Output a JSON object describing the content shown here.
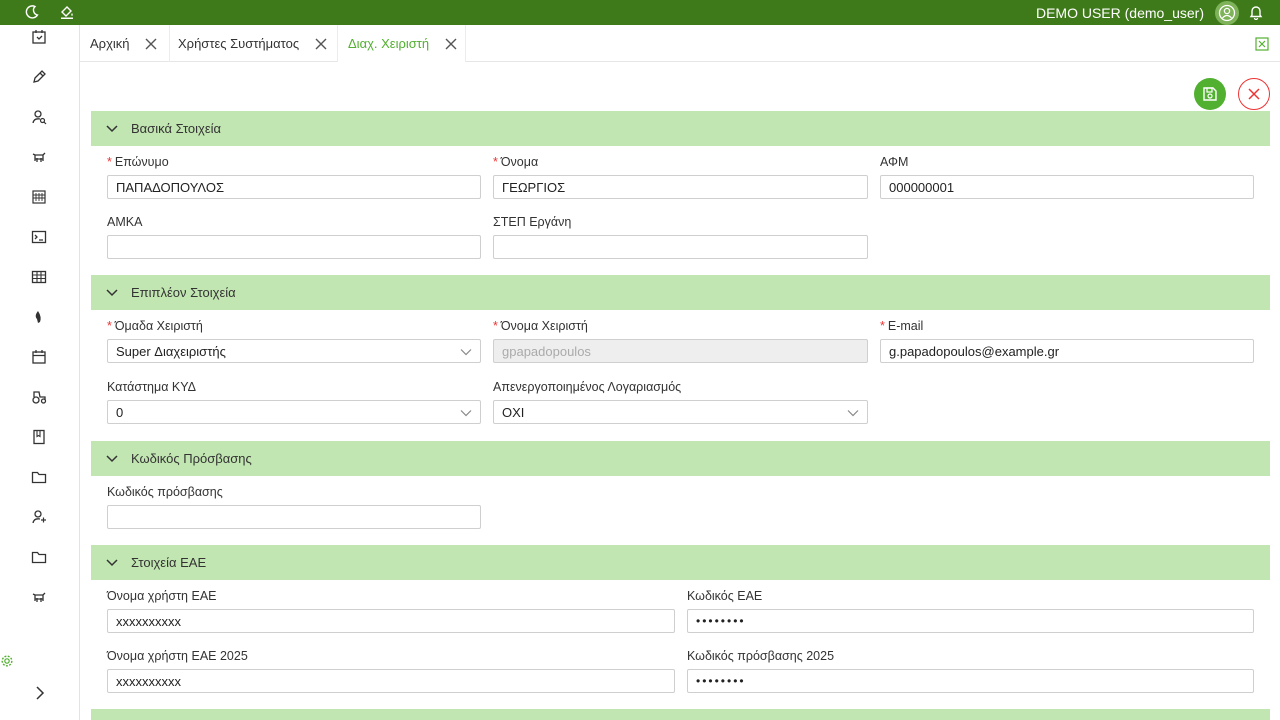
{
  "header": {
    "user_name": "DEMO USER (demo_user)"
  },
  "sidebar": {
    "items": [
      {
        "icon": "calendar-check-icon"
      },
      {
        "icon": "pen-icon"
      },
      {
        "icon": "user-search-icon"
      },
      {
        "icon": "livestock-icon"
      },
      {
        "icon": "building-icon"
      },
      {
        "icon": "terminal-icon"
      },
      {
        "icon": "table-icon"
      },
      {
        "icon": "drop-icon"
      },
      {
        "icon": "calendar-icon"
      },
      {
        "icon": "tractor-icon"
      },
      {
        "icon": "book-icon"
      },
      {
        "icon": "folder-icon"
      },
      {
        "icon": "users-icon"
      },
      {
        "icon": "folder-icon"
      },
      {
        "icon": "livestock-icon"
      }
    ]
  },
  "tabs": [
    {
      "label": "Αρχική"
    },
    {
      "label": "Χρήστες Συστήματος"
    },
    {
      "label": "Διαχ. Χειριστή"
    }
  ],
  "sections": {
    "basic": {
      "title": "Βασικά Στοιχεία",
      "surname_label": "Επώνυμο",
      "surname_value": "ΠΑΠΑΔΟΠΟΥΛΟΣ",
      "name_label": "Όνομα",
      "name_value": "ΓΕΩΡΓΙΟΣ",
      "afm_label": "ΑΦΜ",
      "afm_value": "000000001",
      "amka_label": "ΑΜΚΑ",
      "amka_value": "",
      "step_label": "ΣΤΕΠ Εργάνη",
      "step_value": ""
    },
    "extra": {
      "title": "Επιπλέον Στοιχεία",
      "group_label": "Όμαδα Χειριστή",
      "group_value": "Super Διαχειριστής",
      "username_label": "Όνομα Χειριστή",
      "username_value": "gpapadopoulos",
      "email_label": "E-mail",
      "email_value": "g.papadopoulos@example.gr",
      "store_label": "Κατάστημα ΚΥΔ",
      "store_value": "0",
      "disabled_label": "Απενεργοποιημένος Λογαριασμός",
      "disabled_value": "ΟΧΙ"
    },
    "password": {
      "title": "Κωδικός Πρόσβασης",
      "pw_label": "Κωδικός πρόσβασης",
      "pw_value": ""
    },
    "eae": {
      "title": "Στοιχεία ΕΑΕ",
      "user_label": "Όνομα χρήστη ΕΑΕ",
      "user_value": "xxxxxxxxxx",
      "code_label": "Κωδικός ΕΑΕ",
      "code_value": "••••••••",
      "user2025_label": "Όνομα χρήστη ΕΑΕ 2025",
      "user2025_value": "xxxxxxxxxx",
      "pw2025_label": "Κωδικός πρόσβασης 2025",
      "pw2025_value": "••••••••"
    }
  },
  "colors": {
    "topbar": "#3f7a1a",
    "accent": "#52b030",
    "section_bg": "#c2e6b2",
    "required": "#e33333"
  }
}
